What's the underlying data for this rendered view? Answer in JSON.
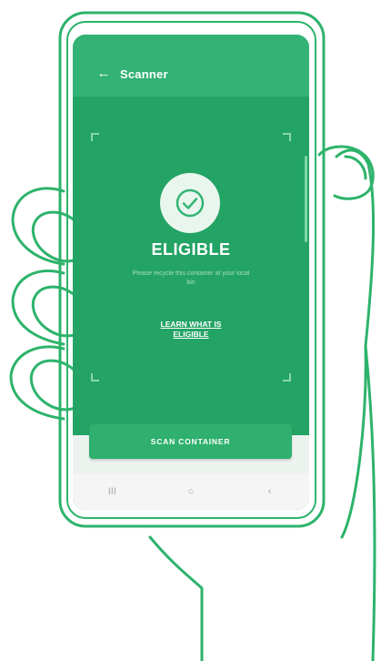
{
  "appbar": {
    "title": "Scanner",
    "back_icon": "arrow-left-icon"
  },
  "result": {
    "title": "ELIGIBLE",
    "subtitle": "Please recycle this container at your local bin",
    "link_line1": "LEARN WHAT IS",
    "link_line2": "ELIGIBLE"
  },
  "actions": {
    "scan_label": "SCAN CONTAINER"
  },
  "navbar": {
    "recents": "III",
    "home": "○",
    "back": "‹"
  },
  "colors": {
    "primary": "#2aa56a",
    "accent": "#32b274",
    "outline": "#2db36b",
    "badge_bg": "#e9f6ee"
  }
}
